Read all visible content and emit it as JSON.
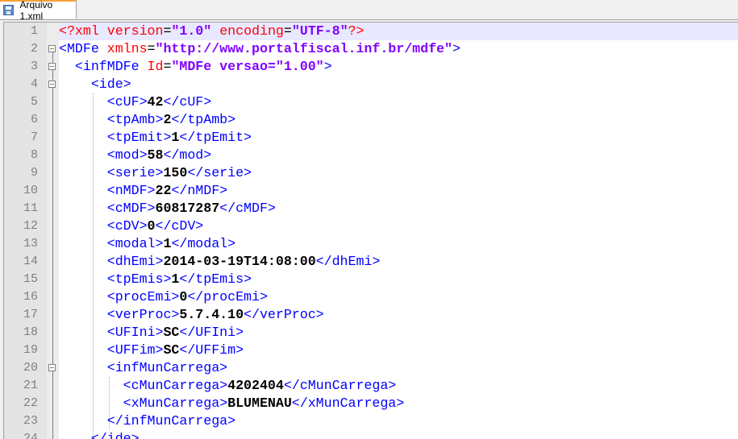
{
  "tab": {
    "label": "Arquivo 1.xml",
    "icon": "save-icon"
  },
  "current_line": 1,
  "lines": [
    {
      "n": "1",
      "indent": 0,
      "fold": "none",
      "parts": [
        {
          "t": "pi",
          "v": "<?xml "
        },
        {
          "t": "pi",
          "v": "version"
        },
        {
          "t": "eq",
          "v": "="
        },
        {
          "t": "val",
          "v": "\"1.0\""
        },
        {
          "t": "pi",
          "v": " encoding"
        },
        {
          "t": "eq",
          "v": "="
        },
        {
          "t": "val",
          "v": "\"UTF-8\""
        },
        {
          "t": "pi",
          "v": "?>"
        }
      ]
    },
    {
      "n": "2",
      "indent": 0,
      "fold": "open",
      "parts": [
        {
          "t": "tag",
          "v": "<MDFe "
        },
        {
          "t": "attr",
          "v": "xmlns"
        },
        {
          "t": "eq",
          "v": "="
        },
        {
          "t": "val",
          "v": "\"http://www.portalfiscal.inf.br/mdfe\""
        },
        {
          "t": "tag",
          "v": ">"
        }
      ]
    },
    {
      "n": "3",
      "indent": 2,
      "fold": "open",
      "parts": [
        {
          "t": "tag",
          "v": "<infMDFe "
        },
        {
          "t": "attr",
          "v": "Id"
        },
        {
          "t": "eq",
          "v": "="
        },
        {
          "t": "val",
          "v": "\"MDFe versao=\"1.00\""
        },
        {
          "t": "tag",
          "v": ">"
        }
      ]
    },
    {
      "n": "4",
      "indent": 4,
      "fold": "open",
      "parts": [
        {
          "t": "tag",
          "v": "<ide>"
        }
      ]
    },
    {
      "n": "5",
      "indent": 6,
      "fold": "none",
      "parts": [
        {
          "t": "tag",
          "v": "<cUF>"
        },
        {
          "t": "text",
          "v": "42"
        },
        {
          "t": "tag",
          "v": "</cUF>"
        }
      ]
    },
    {
      "n": "6",
      "indent": 6,
      "fold": "none",
      "parts": [
        {
          "t": "tag",
          "v": "<tpAmb>"
        },
        {
          "t": "text",
          "v": "2"
        },
        {
          "t": "tag",
          "v": "</tpAmb>"
        }
      ]
    },
    {
      "n": "7",
      "indent": 6,
      "fold": "none",
      "parts": [
        {
          "t": "tag",
          "v": "<tpEmit>"
        },
        {
          "t": "text",
          "v": "1"
        },
        {
          "t": "tag",
          "v": "</tpEmit>"
        }
      ]
    },
    {
      "n": "8",
      "indent": 6,
      "fold": "none",
      "parts": [
        {
          "t": "tag",
          "v": "<mod>"
        },
        {
          "t": "text",
          "v": "58"
        },
        {
          "t": "tag",
          "v": "</mod>"
        }
      ]
    },
    {
      "n": "9",
      "indent": 6,
      "fold": "none",
      "parts": [
        {
          "t": "tag",
          "v": "<serie>"
        },
        {
          "t": "text",
          "v": "150"
        },
        {
          "t": "tag",
          "v": "</serie>"
        }
      ]
    },
    {
      "n": "10",
      "indent": 6,
      "fold": "none",
      "parts": [
        {
          "t": "tag",
          "v": "<nMDF>"
        },
        {
          "t": "text",
          "v": "22"
        },
        {
          "t": "tag",
          "v": "</nMDF>"
        }
      ]
    },
    {
      "n": "11",
      "indent": 6,
      "fold": "none",
      "parts": [
        {
          "t": "tag",
          "v": "<cMDF>"
        },
        {
          "t": "text",
          "v": "60817287"
        },
        {
          "t": "tag",
          "v": "</cMDF>"
        }
      ]
    },
    {
      "n": "12",
      "indent": 6,
      "fold": "none",
      "parts": [
        {
          "t": "tag",
          "v": "<cDV>"
        },
        {
          "t": "text",
          "v": "0"
        },
        {
          "t": "tag",
          "v": "</cDV>"
        }
      ]
    },
    {
      "n": "13",
      "indent": 6,
      "fold": "none",
      "parts": [
        {
          "t": "tag",
          "v": "<modal>"
        },
        {
          "t": "text",
          "v": "1"
        },
        {
          "t": "tag",
          "v": "</modal>"
        }
      ]
    },
    {
      "n": "14",
      "indent": 6,
      "fold": "none",
      "parts": [
        {
          "t": "tag",
          "v": "<dhEmi>"
        },
        {
          "t": "text",
          "v": "2014-03-19T14:08:00"
        },
        {
          "t": "tag",
          "v": "</dhEmi>"
        }
      ]
    },
    {
      "n": "15",
      "indent": 6,
      "fold": "none",
      "parts": [
        {
          "t": "tag",
          "v": "<tpEmis>"
        },
        {
          "t": "text",
          "v": "1"
        },
        {
          "t": "tag",
          "v": "</tpEmis>"
        }
      ]
    },
    {
      "n": "16",
      "indent": 6,
      "fold": "none",
      "parts": [
        {
          "t": "tag",
          "v": "<procEmi>"
        },
        {
          "t": "text",
          "v": "0"
        },
        {
          "t": "tag",
          "v": "</procEmi>"
        }
      ]
    },
    {
      "n": "17",
      "indent": 6,
      "fold": "none",
      "parts": [
        {
          "t": "tag",
          "v": "<verProc>"
        },
        {
          "t": "text",
          "v": "5.7.4.10"
        },
        {
          "t": "tag",
          "v": "</verProc>"
        }
      ]
    },
    {
      "n": "18",
      "indent": 6,
      "fold": "none",
      "parts": [
        {
          "t": "tag",
          "v": "<UFIni>"
        },
        {
          "t": "text",
          "v": "SC"
        },
        {
          "t": "tag",
          "v": "</UFIni>"
        }
      ]
    },
    {
      "n": "19",
      "indent": 6,
      "fold": "none",
      "parts": [
        {
          "t": "tag",
          "v": "<UFFim>"
        },
        {
          "t": "text",
          "v": "SC"
        },
        {
          "t": "tag",
          "v": "</UFFim>"
        }
      ]
    },
    {
      "n": "20",
      "indent": 6,
      "fold": "open",
      "parts": [
        {
          "t": "tag",
          "v": "<infMunCarrega>"
        }
      ]
    },
    {
      "n": "21",
      "indent": 8,
      "fold": "none",
      "parts": [
        {
          "t": "tag",
          "v": "<cMunCarrega>"
        },
        {
          "t": "text",
          "v": "4202404"
        },
        {
          "t": "tag",
          "v": "</cMunCarrega>"
        }
      ]
    },
    {
      "n": "22",
      "indent": 8,
      "fold": "none",
      "parts": [
        {
          "t": "tag",
          "v": "<xMunCarrega>"
        },
        {
          "t": "text",
          "v": "BLUMENAU"
        },
        {
          "t": "tag",
          "v": "</xMunCarrega>"
        }
      ]
    },
    {
      "n": "23",
      "indent": 6,
      "fold": "end",
      "parts": [
        {
          "t": "tag",
          "v": "</infMunCarrega>"
        }
      ]
    },
    {
      "n": "24",
      "indent": 4,
      "fold": "end",
      "parts": [
        {
          "t": "tag",
          "v": "</ide>"
        }
      ]
    }
  ]
}
